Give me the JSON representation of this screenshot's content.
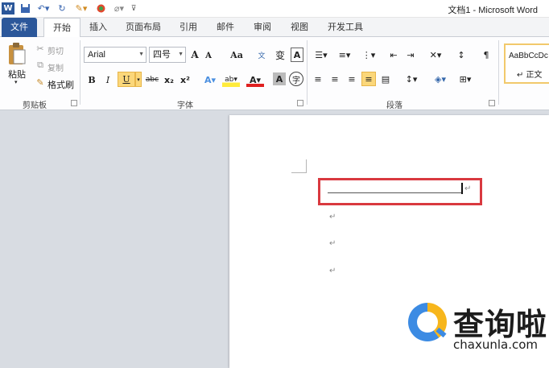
{
  "window": {
    "title": "文档1 - Microsoft Word"
  },
  "tabs": [
    "文件",
    "开始",
    "插入",
    "页面布局",
    "引用",
    "邮件",
    "审阅",
    "视图",
    "开发工具"
  ],
  "clipboard": {
    "paste": "粘贴",
    "cut": "剪切",
    "copy": "复制",
    "format_painter": "格式刷",
    "group_label": "剪贴板"
  },
  "font": {
    "family": "Arial",
    "size": "四号",
    "grow": "A",
    "shrink": "A",
    "change_case": "Aa",
    "bold": "B",
    "italic": "I",
    "underline": "U",
    "strike": "abc",
    "subscript": "x₂",
    "superscript": "x²",
    "group_label": "字体"
  },
  "paragraph": {
    "group_label": "段落"
  },
  "styles": {
    "sample": "AaBbCcDc",
    "normal": "↵ 正文"
  },
  "document": {
    "paragraph_marks": [
      "↵",
      "↵",
      "↵",
      "↵"
    ]
  },
  "watermark": {
    "text": "查询啦",
    "url": "chaxunla.com"
  },
  "colors": {
    "accent": "#2b579a",
    "highlight_box": "#d9393f"
  }
}
